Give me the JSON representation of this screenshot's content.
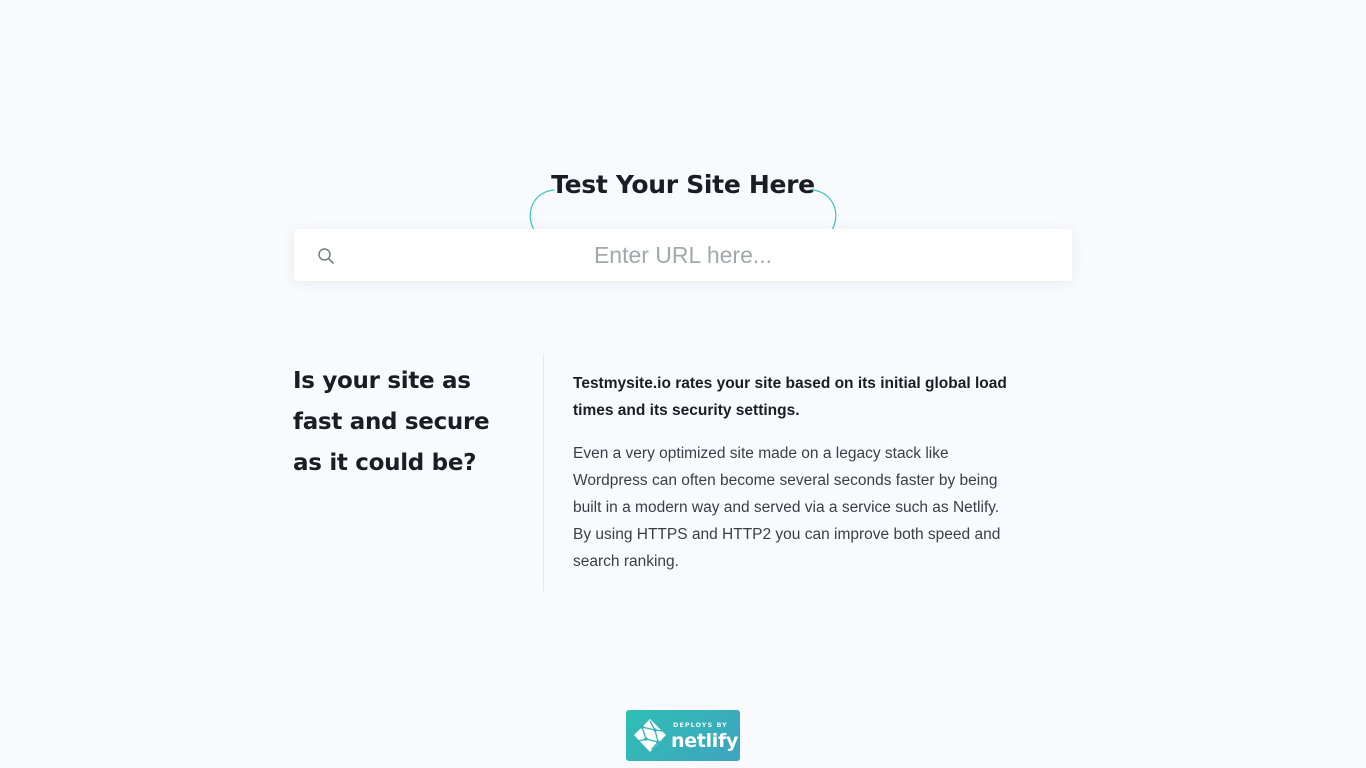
{
  "hero": {
    "title": "Test Your Site Here"
  },
  "search": {
    "placeholder": "Enter URL here...",
    "value": "",
    "icon": "search-icon"
  },
  "info": {
    "heading": "Is your site as fast and secure as it could be?",
    "lead": "Testmysite.io rates your site based on its initial global load times and its security settings.",
    "body": "Even a very optimized site made on a legacy stack like Wordpress can often become several seconds faster by being built in a modern way and served via a service such as Netlify. By using HTTPS and HTTP2 you can improve both speed and search ranking."
  },
  "badge": {
    "small_text": "Deploys by",
    "brand": "netlify",
    "icon": "netlify-logo-icon"
  },
  "colors": {
    "background": "#f9fafd",
    "accent": "#2fbfb4",
    "text": "#1a1d21"
  }
}
